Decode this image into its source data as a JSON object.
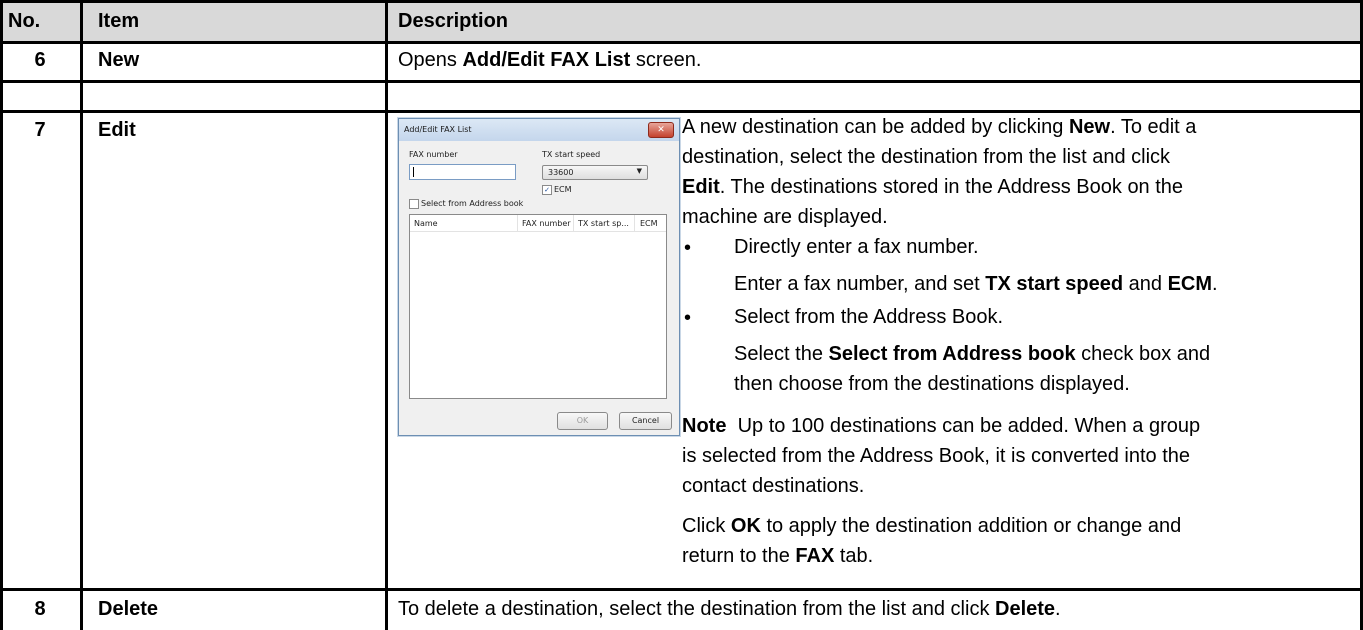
{
  "headers": {
    "no": "No.",
    "item": "Item",
    "description": "Description"
  },
  "rows": [
    {
      "no": "6",
      "item": "New",
      "desc_parts": [
        "Opens ",
        "Add/Edit FAX List",
        " screen."
      ]
    },
    {
      "no": "7",
      "item": "Edit"
    },
    {
      "no": "8",
      "item": "Delete",
      "desc_parts": [
        "To delete a destination, select the destination from the list and click ",
        "Delete",
        "."
      ]
    }
  ],
  "edit": {
    "p1": {
      "l1": [
        "A new destination can be added by clicking ",
        "New",
        ". To edit a"
      ],
      "l2": "destination, select the destination from the list and click",
      "l3": [
        "Edit",
        ". The destinations stored in the Address Book on the"
      ],
      "l4": "machine are displayed."
    },
    "bullet_char": "•",
    "b1": "Directly enter a fax number.",
    "b1_sub": [
      "Enter a fax number, and set ",
      "TX start speed",
      " and ",
      "ECM",
      "."
    ],
    "b2": "Select from the Address Book.",
    "b2_sub1": [
      "Select the ",
      "Select from Address book",
      " check box and"
    ],
    "b2_sub2": "then choose from the destinations displayed.",
    "note": {
      "l1": [
        "Note",
        "  Up to 100 destinations can be added. When a group"
      ],
      "l2": "is selected from the Address Book, it is converted into the",
      "l3": "contact destinations."
    },
    "ok": {
      "l1": [
        "Click ",
        "OK",
        " to apply the destination addition or change and"
      ],
      "l2": [
        "return to the ",
        "FAX",
        " tab."
      ]
    }
  },
  "dialog": {
    "title": "Add/Edit FAX List",
    "close_glyph": "✕",
    "fax_number_label": "FAX number",
    "tx_speed_label": "TX start speed",
    "tx_speed_value": "33600",
    "dropdown_glyph": "▼",
    "ecm_label": "ECM",
    "ecm_checked": true,
    "check_glyph": "✓",
    "select_address_label": "Select from Address book",
    "columns": [
      "Name",
      "FAX number",
      "TX start sp...",
      "ECM"
    ],
    "ok_label": "OK",
    "cancel_label": "Cancel"
  }
}
